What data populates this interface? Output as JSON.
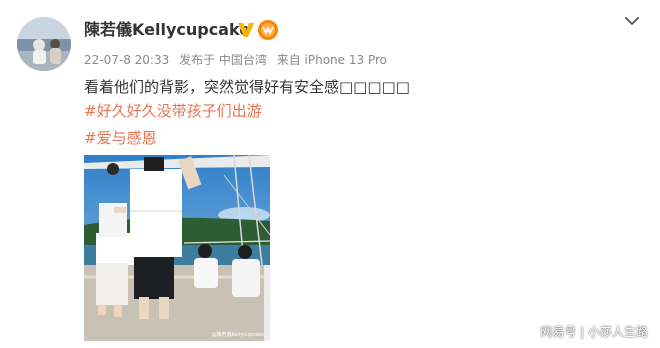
{
  "post": {
    "author": "陳若儀Kellycupcake",
    "date": "22-07-8 20:33",
    "published_from": "发布于 中国台湾",
    "device": "来自 iPhone 13 Pro",
    "text": "看着他们的背影，突然觉得好有安全感□□□□□",
    "tags": [
      "#好久好久没带孩子们出游",
      "#爱与感恩"
    ],
    "photo_watermark": "@陳若儀Kellycupcake"
  },
  "icons": {
    "verified": "verified-v-icon",
    "member": "vip-member-icon",
    "menu": "chevron-down-icon"
  },
  "colors": {
    "tag": "#eb7350",
    "verified": "#f7b500",
    "member": "#ff8200",
    "meta": "#8a8a8a"
  },
  "source_watermark": "网易号 | 小莎人生路"
}
